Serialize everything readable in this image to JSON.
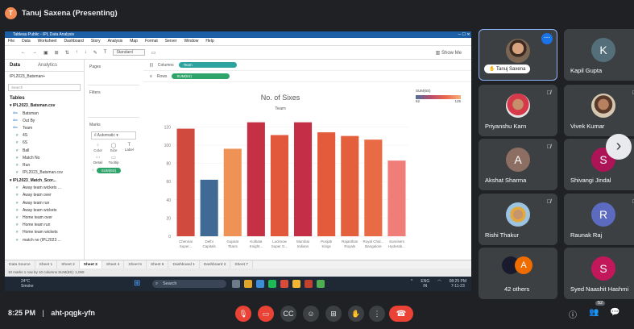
{
  "meeting": {
    "presenter_initial": "T",
    "presenter_label": "Tanuj Saxena (Presenting)",
    "time": "8:25 PM",
    "separator": "|",
    "code": "aht-pqgk-yfn",
    "participants_badge": "52"
  },
  "tableau": {
    "window_title": "Tableau Public - IPL Data Analysis",
    "menu": [
      "File",
      "Data",
      "Worksheet",
      "Dashboard",
      "Story",
      "Analysis",
      "Map",
      "Format",
      "Server",
      "Window",
      "Help"
    ],
    "show_me": "Show Me",
    "fit_dropdown": "Standard",
    "data_tab": "Data",
    "analytics_tab": "Analytics",
    "datasource": "IPL2023_Batsman+",
    "search_placeholder": "Search",
    "tables_label": "Tables",
    "table1": "IPL2023_Batsman.csv",
    "table1_fields": [
      "Batsman",
      "Out By",
      "Team",
      "4S",
      "6S",
      "Ball",
      "Match No",
      "Run",
      "IPL2023_Batsman.csv"
    ],
    "table2": "IPL2023_Match_Scor...",
    "table2_fields": [
      "Away team wickets ...",
      "Away team over",
      "Away team run",
      "Away team wickets",
      "Home team over",
      "Home team run",
      "Home team wickets",
      "match no (IPL2023 ..."
    ],
    "pages_label": "Pages",
    "filters_label": "Filters",
    "marks_label": "Marks",
    "marks_type": "Automatic",
    "mark_buttons": [
      "Color",
      "Size",
      "Label",
      "Detail",
      "Tooltip"
    ],
    "marks_pill": "SUM(6S)",
    "columns_label": "Columns",
    "columns_pill": "Team",
    "rows_label": "Rows",
    "rows_pill": "SUM(6S)",
    "legend_title": "SUM(6S)",
    "legend_min": "62",
    "legend_max": "125",
    "sheet_tabs": [
      "Data Source",
      "Sheet 1",
      "Sheet 2",
      "Sheet 3",
      "Sheet 4",
      "Sheet 5",
      "Sheet 6",
      "Dashboard 1",
      "Dashboard 2",
      "Sheet 7"
    ],
    "active_tab": "Sheet 3",
    "status": "10 marks    1 row by 10 columns    SUM(6S): 1,069"
  },
  "chart_data": {
    "type": "bar",
    "title": "No. of Sixes",
    "xlabel": "Team",
    "ylabel": "",
    "ylim": [
      0,
      130
    ],
    "yticks": [
      0,
      20,
      40,
      60,
      80,
      100,
      120
    ],
    "categories": [
      [
        "Chennai",
        "Super..."
      ],
      [
        "Delhi",
        "Capitals"
      ],
      [
        "Gujarat",
        "Titans"
      ],
      [
        "Kolkata",
        "Knight..."
      ],
      [
        "Lucknow",
        "Super G..."
      ],
      [
        "Mumbai",
        "Indians"
      ],
      [
        "Punjab",
        "Kings"
      ],
      [
        "Rajasthan",
        "Royals"
      ],
      [
        "Royal Chal...",
        "Bangalore"
      ],
      [
        "Sunrisers",
        "Hyderab..."
      ]
    ],
    "values": [
      118,
      62,
      96,
      125,
      111,
      125,
      114,
      110,
      106,
      83
    ],
    "colors": [
      "#d04a3e",
      "#3e6a95",
      "#ef9255",
      "#c63045",
      "#e2583a",
      "#c42f47",
      "#e45b3b",
      "#e4603d",
      "#e86b45",
      "#f07d78"
    ]
  },
  "windows_taskbar": {
    "weather_temp": "24°C",
    "weather_text": "Smoke",
    "search": "Search",
    "lang1": "ENG",
    "lang2": "IN",
    "clock_time": "08:25 PM",
    "clock_date": "7-11-23"
  },
  "tiles": [
    {
      "name": "Tanuj Saxena"
    },
    {
      "name": "Kapil Gupta",
      "initial": "K",
      "color": "#546e7a"
    },
    {
      "name": "Priyanshu Karn"
    },
    {
      "name": "Vivek Kumar"
    },
    {
      "name": "Akshat Sharma",
      "initial": "A",
      "color": "#8d6e63"
    },
    {
      "name": "Shivangi Jindal",
      "initial": "S",
      "color": "#ad1457"
    },
    {
      "name": "Rishi Thakur"
    },
    {
      "name": "Raunak Raj",
      "initial": "R",
      "color": "#5c6bc0"
    },
    {
      "name": "42 others",
      "initial": "A",
      "color": "#ef6c00"
    },
    {
      "name": "Syed Naashit Hashmi",
      "initial": "S",
      "color": "#c2185b"
    }
  ]
}
